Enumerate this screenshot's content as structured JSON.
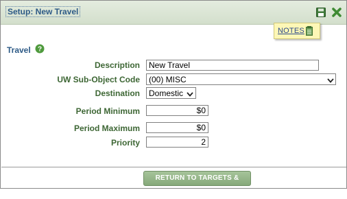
{
  "window": {
    "title": "Setup: New Travel"
  },
  "notes": {
    "label": "NOTES"
  },
  "section": {
    "title": "Travel"
  },
  "form": {
    "description": {
      "label": "Description",
      "value": "New Travel"
    },
    "sub_object_code": {
      "label": "UW Sub-Object Code",
      "value": "(00) MISC"
    },
    "destination": {
      "label": "Destination",
      "value": "Domestic"
    },
    "period_minimum": {
      "label": "Period Minimum",
      "value": "$0"
    },
    "period_maximum": {
      "label": "Period Maximum",
      "value": "$0"
    },
    "priority": {
      "label": "Priority",
      "value": "2"
    }
  },
  "footer": {
    "return_button_label": "RETURN TO TARGETS & LIMITS"
  },
  "icons": {
    "save": "save-icon",
    "close": "close-icon",
    "notes": "notepad-icon",
    "help": "help-icon",
    "chevron": "chevron-down-icon"
  },
  "colors": {
    "accent_green": "#3d6634",
    "title_blue": "#2d5a86",
    "close_green": "#3f8a33",
    "button_green": "#8fb083",
    "notes_yellow": "#fdf7b6"
  }
}
